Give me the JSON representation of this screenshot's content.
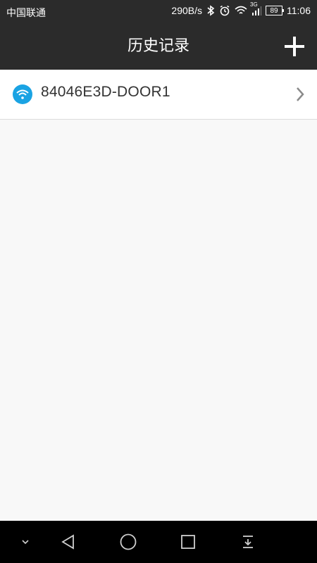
{
  "status_bar": {
    "carrier": "中国联通",
    "network_speed": "290B/s",
    "network_type": "3G",
    "battery": "89",
    "time": "11:06",
    "icons": [
      "bluetooth-icon",
      "alarm-icon",
      "wifi-icon",
      "signal-icon",
      "battery-icon"
    ]
  },
  "appbar": {
    "title": "历史记录",
    "add_icon": "plus-icon"
  },
  "history": {
    "items": [
      {
        "label": "84046E3D-DOOR1",
        "icon": "wifi-icon",
        "trailing_icon": "chevron-right-icon"
      }
    ]
  },
  "nav_bar": {
    "buttons": [
      "chevron-down-icon",
      "back-icon",
      "home-icon",
      "recents-icon",
      "notification-pull-icon"
    ]
  },
  "colors": {
    "bar_bg": "#2b2b2b",
    "accent_blue": "#1aa3e3",
    "list_bg": "#ffffff",
    "page_bg": "#f8f8f8"
  }
}
